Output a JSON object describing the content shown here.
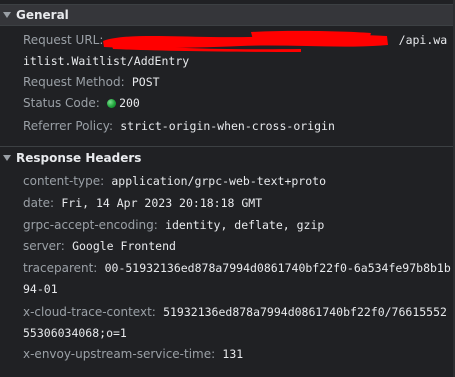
{
  "general": {
    "title": "General",
    "request_url_label": "Request URL:",
    "request_url_value": "/api.waitlist.Waitlist/AddEntry",
    "request_method_label": "Request Method:",
    "request_method_value": "POST",
    "status_code_label": "Status Code:",
    "status_code_value": "200",
    "referrer_policy_label": "Referrer Policy:",
    "referrer_policy_value": "strict-origin-when-cross-origin"
  },
  "response_headers": {
    "title": "Response Headers",
    "items": [
      {
        "key": "content-type:",
        "value": "application/grpc-web-text+proto"
      },
      {
        "key": "date:",
        "value": "Fri, 14 Apr 2023 20:18:18 GMT"
      },
      {
        "key": "grpc-accept-encoding:",
        "value": "identity, deflate, gzip"
      },
      {
        "key": "server:",
        "value": "Google Frontend"
      },
      {
        "key": "traceparent:",
        "value": "00-51932136ed878a7994d0861740bf22f0-6a534fe97b8b1b94-01"
      },
      {
        "key": "x-cloud-trace-context:",
        "value": "51932136ed878a7994d0861740bf22f0/7661555255306034068;o=1"
      },
      {
        "key": "x-envoy-upstream-service-time:",
        "value": "131"
      }
    ]
  },
  "colors": {
    "background": "#202124",
    "header_bg": "#35363a",
    "key_text": "#9aa0a6",
    "value_text": "#e8eaed",
    "redaction": "#ff0000",
    "status_ok": "#1fa33b"
  }
}
